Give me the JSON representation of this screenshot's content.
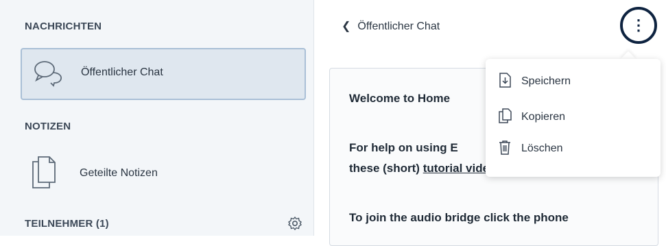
{
  "sidebar": {
    "messages_title": "NACHRICHTEN",
    "public_chat_label": "Öffentlicher Chat",
    "notes_title": "NOTIZEN",
    "shared_notes_label": "Geteilte Notizen",
    "participants_title": "TEILNEHMER (1)"
  },
  "chat": {
    "header_title": "Öffentlicher Chat",
    "welcome_prefix": "Welcome to ",
    "welcome_bold": "Home",
    "help_line1": "For help on using E",
    "help_line2_prefix": "these (short) ",
    "help_link": "tutorial videos",
    "help_line2_suffix": ".",
    "audio_line": "To join the audio bridge click the phone"
  },
  "menu": {
    "items": [
      {
        "label": "Speichern",
        "icon": "save-icon"
      },
      {
        "label": "Kopieren",
        "icon": "copy-icon"
      },
      {
        "label": "Löschen",
        "icon": "trash-icon"
      }
    ]
  }
}
